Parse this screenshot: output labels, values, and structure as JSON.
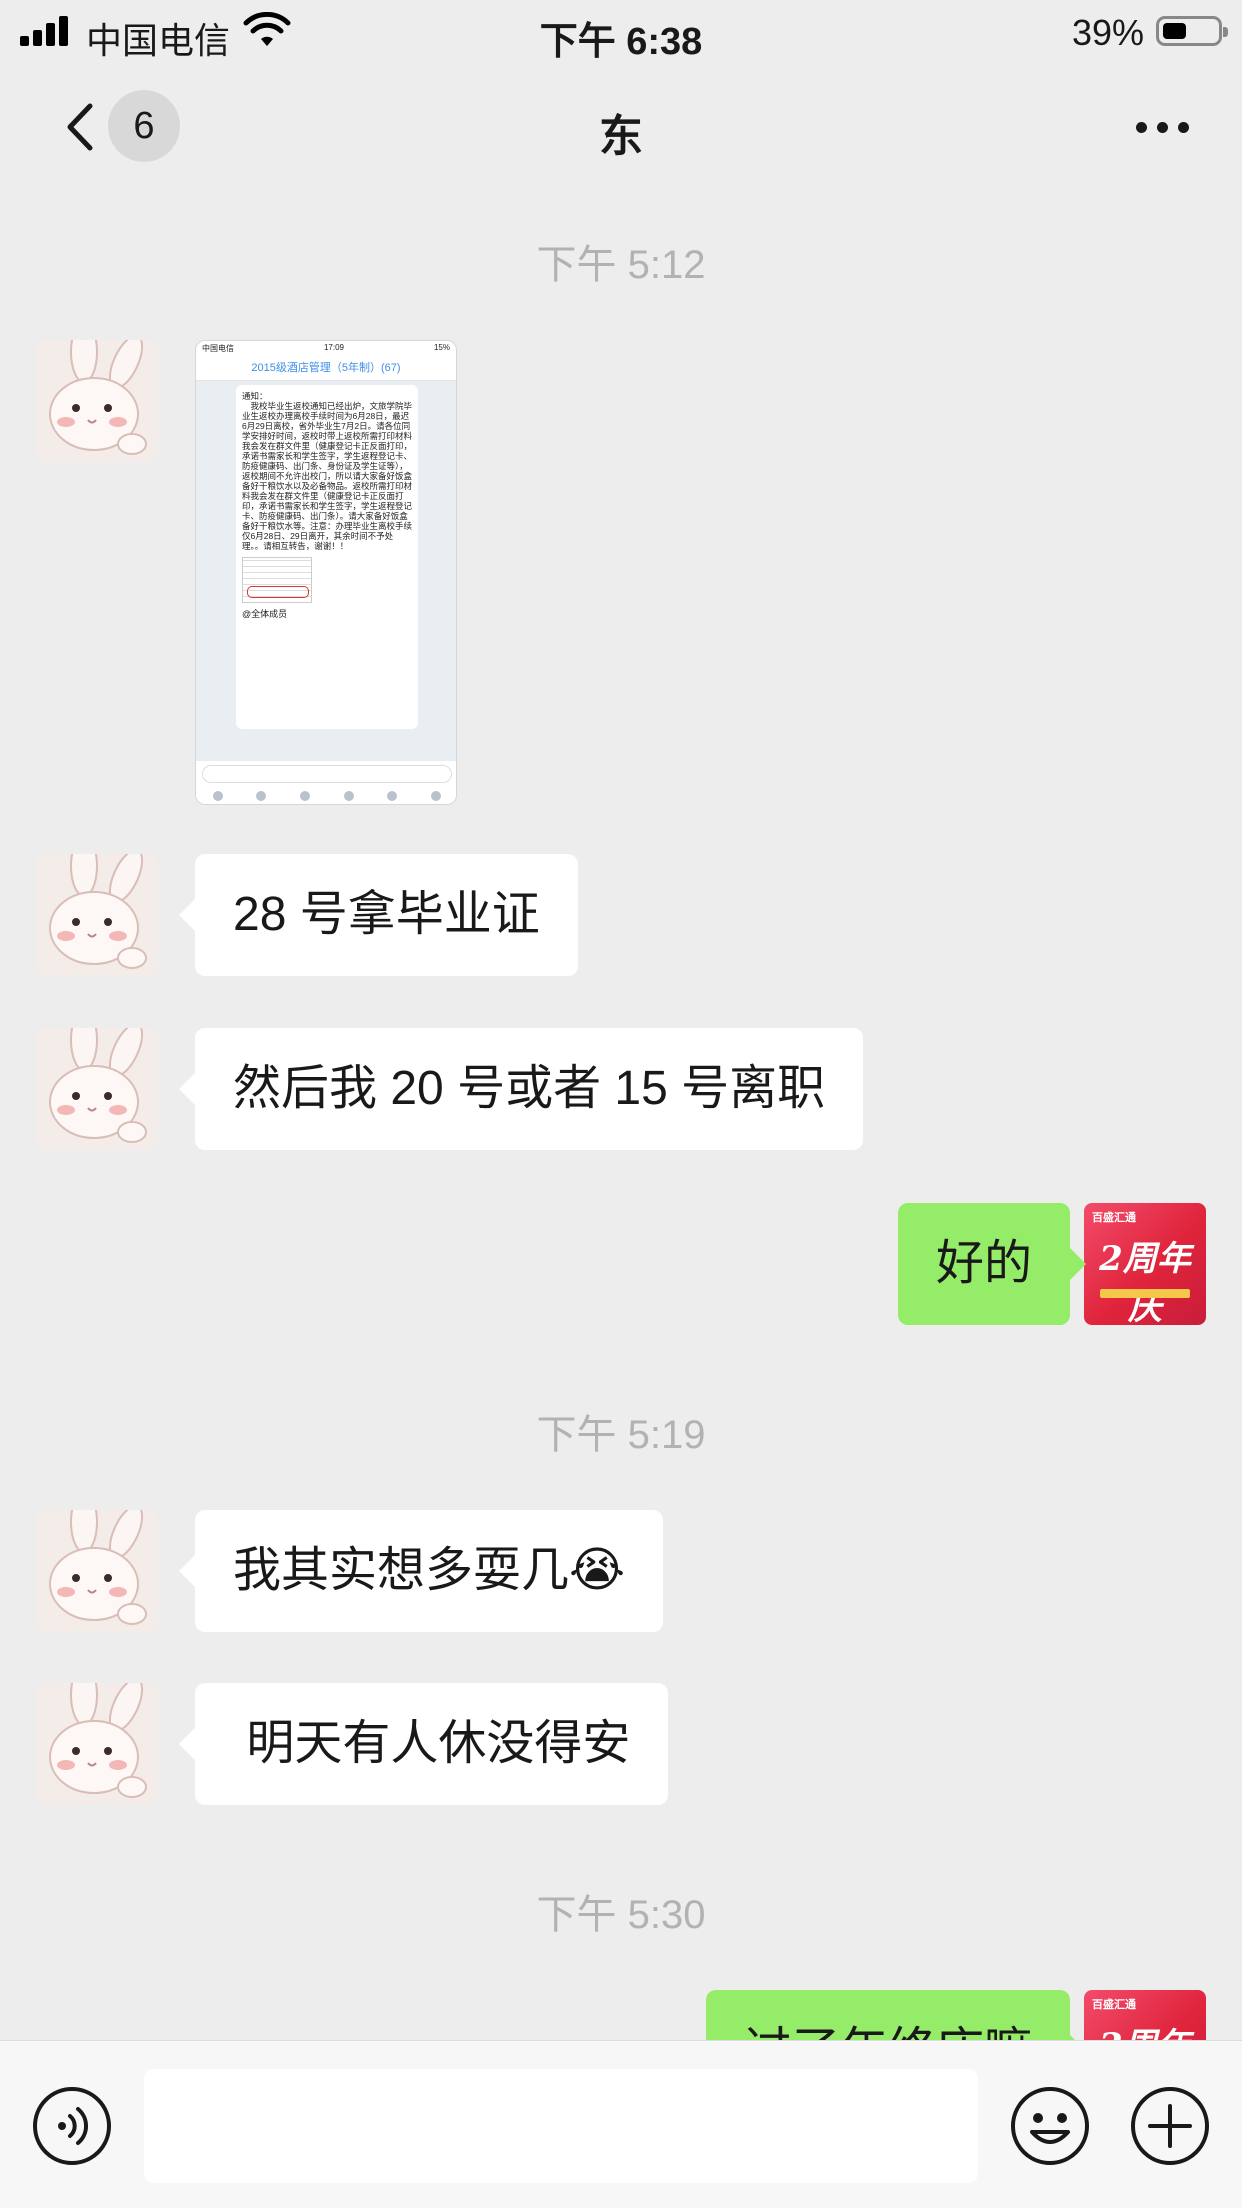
{
  "status_bar": {
    "carrier": "中国电信",
    "time": "下午 6:38",
    "battery_percent": "39%",
    "battery_level": 0.39
  },
  "nav": {
    "unread_count": "6",
    "title": "东"
  },
  "chat": {
    "timestamps": [
      "下午 5:12",
      "下午 5:19",
      "下午 5:30"
    ],
    "shared_image": {
      "status_left": "中国电信",
      "status_time": "17:09",
      "status_right": "15%",
      "group_title": "2015级酒店管理（5年制）(67)",
      "notice_text": "通知：\n　我校毕业生返校通知已经出炉，文旅学院毕业生返校办理离校手续时间为6月28日，最迟6月29日离校，省外毕业生7月2日。请各位同学安排好时间，返校时带上返校所需打印材料我会发在群文件里（健康登记卡正反面打印，承诺书需家长和学生签字，学生返程登记卡、防疫健康码、出门条、身份证及学生证等），返校期间不允许出校门，所以请大家备好饭盒备好干粮饮水以及必备物品。返校所需打印材料我会发在群文件里（健康登记卡正反面打印，承诺书需家长和学生签字，学生返程登记卡、防疫健康码、出门条）。请大家备好饭盒备好干粮饮水等。注意：办理毕业生离校手续仅6月28日、29日离开，其余时间不予处理。。请相互转告，谢谢！！",
      "mention": "@全体成员"
    },
    "messages": [
      {
        "side": "left",
        "text": "28 号拿毕业证"
      },
      {
        "side": "left",
        "text": "然后我 20 号或者 15 号离职"
      },
      {
        "side": "right",
        "text": "好的"
      },
      {
        "side": "left",
        "text": "我其实想多耍几😭"
      },
      {
        "side": "left",
        "text": " 明天有人休没得安"
      },
      {
        "side": "right",
        "text": "过了年终庆嘛"
      }
    ],
    "sticker": {
      "brand": "百盛汇通",
      "title": "2周年庆"
    }
  },
  "input_bar": {
    "value": "",
    "placeholder": ""
  },
  "colors": {
    "background": "#ededed",
    "sent_bubble": "#95ec69",
    "received_bubble": "#ffffff",
    "timestamp": "#b2b2b2"
  }
}
